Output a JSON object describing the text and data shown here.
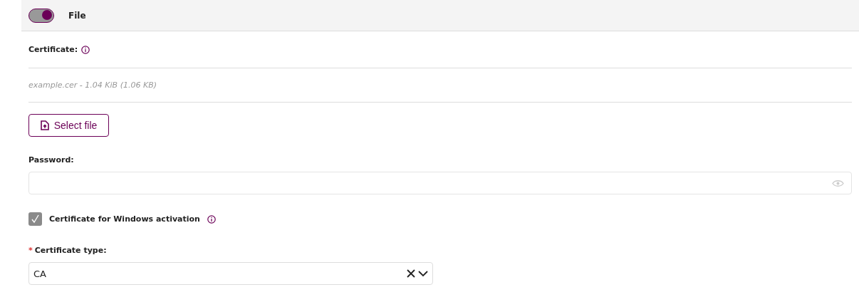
{
  "header": {
    "toggle_on": true,
    "label": "File"
  },
  "certificate": {
    "label": "Certificate:",
    "file_info": "example.cer - 1.04 KiB (1.06 KB)",
    "button": "Select file"
  },
  "password": {
    "label": "Password:"
  },
  "windows_activation": {
    "label": "Certificate for Windows activation",
    "checked": true
  },
  "certificate_type": {
    "label": "Certificate type:",
    "required_mark": "*",
    "value": "CA"
  }
}
